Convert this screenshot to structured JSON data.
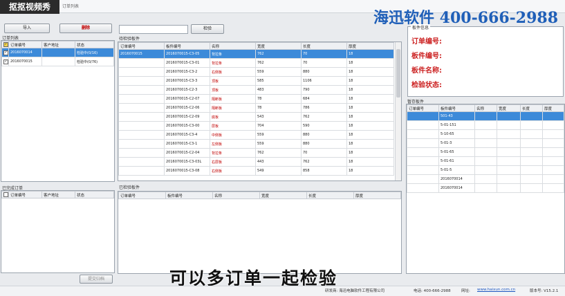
{
  "window": {
    "watermark": "抠抠视频秀",
    "title": "订单列表",
    "brand": "海迅软件 400-666-2988"
  },
  "toolbar": {
    "import_label": "导入",
    "delete_label": "删除",
    "search_label": "检验"
  },
  "order_list": {
    "label": "订单列表",
    "columns": [
      "",
      "订单编号",
      "客户地址",
      "状态"
    ],
    "rows": [
      {
        "checked": true,
        "order_no": "2016070014",
        "address": "",
        "status": "检验中(0/16)"
      },
      {
        "checked": true,
        "order_no": "2016070015",
        "address": "",
        "status": "检验中(0/76)"
      }
    ]
  },
  "checked_orders": {
    "label": "已完成订单",
    "columns": [
      "",
      "订单编号",
      "客户地址",
      "状态"
    ],
    "submit_label": "提交归档"
  },
  "pending_boards": {
    "label": "待检验板件",
    "columns": [
      "订单编号",
      "板件编号",
      "名称",
      "宽度",
      "长度",
      "厚度"
    ],
    "rows": [
      [
        "2016070015",
        "2016070015-C3-05",
        "背拉条",
        "762",
        "70",
        "18"
      ],
      [
        "",
        "2016070015-C3-01",
        "背拉条",
        "762",
        "70",
        "18"
      ],
      [
        "",
        "2016070015-C3-2",
        "右侧板",
        "559",
        "880",
        "18"
      ],
      [
        "",
        "2016070015-C3-3",
        "顶板",
        "585",
        "1106",
        "18"
      ],
      [
        "",
        "2016070015-C2-3",
        "顶板",
        "483",
        "790",
        "18"
      ],
      [
        "",
        "2016070015-C2-07",
        "隔断板",
        "78",
        "684",
        "18"
      ],
      [
        "",
        "2016070015-C2-06",
        "隔断板",
        "78",
        "786",
        "18"
      ],
      [
        "",
        "2016070015-C2-09",
        "底板",
        "543",
        "762",
        "18"
      ],
      [
        "",
        "2016070015-C3-00",
        "层板",
        "704",
        "590",
        "18"
      ],
      [
        "",
        "2016070015-C3-4",
        "中侧板",
        "559",
        "880",
        "18"
      ],
      [
        "",
        "2016070015-C3-1",
        "左侧板",
        "559",
        "880",
        "18"
      ],
      [
        "",
        "2016070015-C2-04",
        "背拉条",
        "762",
        "70",
        "18"
      ],
      [
        "",
        "2016070015-C3-03L",
        "右层板",
        "443",
        "762",
        "18"
      ],
      [
        "",
        "2016070015-C3-08",
        "右侧板",
        "549",
        "858",
        "18"
      ]
    ]
  },
  "checked_boards": {
    "label": "已检验板件",
    "columns": [
      "订单编号",
      "板件编号",
      "名称",
      "宽度",
      "长度",
      "厚度"
    ]
  },
  "board_info": {
    "label": "板件信息",
    "order_no_label": "订单编号:",
    "board_no_label": "板件编号:",
    "board_name_label": "板件名称:",
    "check_status_label": "检验状态:"
  },
  "stage_boards": {
    "label": "暂存板件",
    "columns": [
      "订单编号",
      "板件编号",
      "名称",
      "宽度",
      "长度",
      "厚度"
    ],
    "rows": [
      [
        "",
        "501-43",
        "",
        "",
        "",
        ""
      ],
      [
        "",
        "5-01-151",
        "",
        "",
        "",
        ""
      ],
      [
        "",
        "5-10-65",
        "",
        "",
        "",
        ""
      ],
      [
        "",
        "5-01-3",
        "",
        "",
        "",
        ""
      ],
      [
        "",
        "5-01-65",
        "",
        "",
        "",
        ""
      ],
      [
        "",
        "5-01-61",
        "",
        "",
        "",
        ""
      ],
      [
        "",
        "5-01-5",
        "",
        "",
        "",
        ""
      ],
      [
        "",
        "2016070014",
        "",
        "",
        "",
        ""
      ],
      [
        "",
        "2016070014",
        "",
        "",
        "",
        ""
      ]
    ]
  },
  "caption": "可以多订单一起检验",
  "status": {
    "company": "研发商: 海迅电脑软件工程有限公司",
    "phone": "电话: 400-666-2988",
    "website_label": "网址:",
    "website": "www.haixun.com.cn",
    "version": "版本号: V15.2.1"
  }
}
